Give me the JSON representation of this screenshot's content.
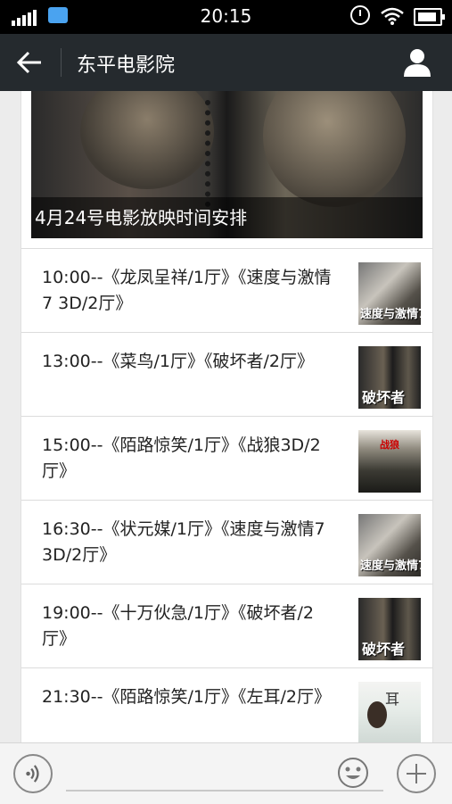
{
  "status": {
    "time": "20:15"
  },
  "header": {
    "title": "东平电影院"
  },
  "cover": {
    "caption": "4月24号电影放映时间安排"
  },
  "schedule": [
    {
      "text": "10:00--《龙凤呈祥/1厅》《速度与激情7 3D/2厅》",
      "thumb": "fast-furious-7-poster"
    },
    {
      "text": "13:00--《菜鸟/1厅》《破坏者/2厅》",
      "thumb": "sabotage-poster"
    },
    {
      "text": "15:00--《陌路惊笑/1厅》《战狼3D/2厅》",
      "thumb": "wolf-warriors-poster"
    },
    {
      "text": "16:30--《状元媒/1厅》《速度与激情7 3D/2厅》",
      "thumb": "fast-furious-7-poster"
    },
    {
      "text": "19:00--《十万伙急/1厅》《破坏者/2厅》",
      "thumb": "sabotage-poster"
    },
    {
      "text": "21:30--《陌路惊笑/1厅》《左耳/2厅》",
      "thumb": "left-ear-poster"
    }
  ],
  "composer": {
    "placeholder": ""
  }
}
